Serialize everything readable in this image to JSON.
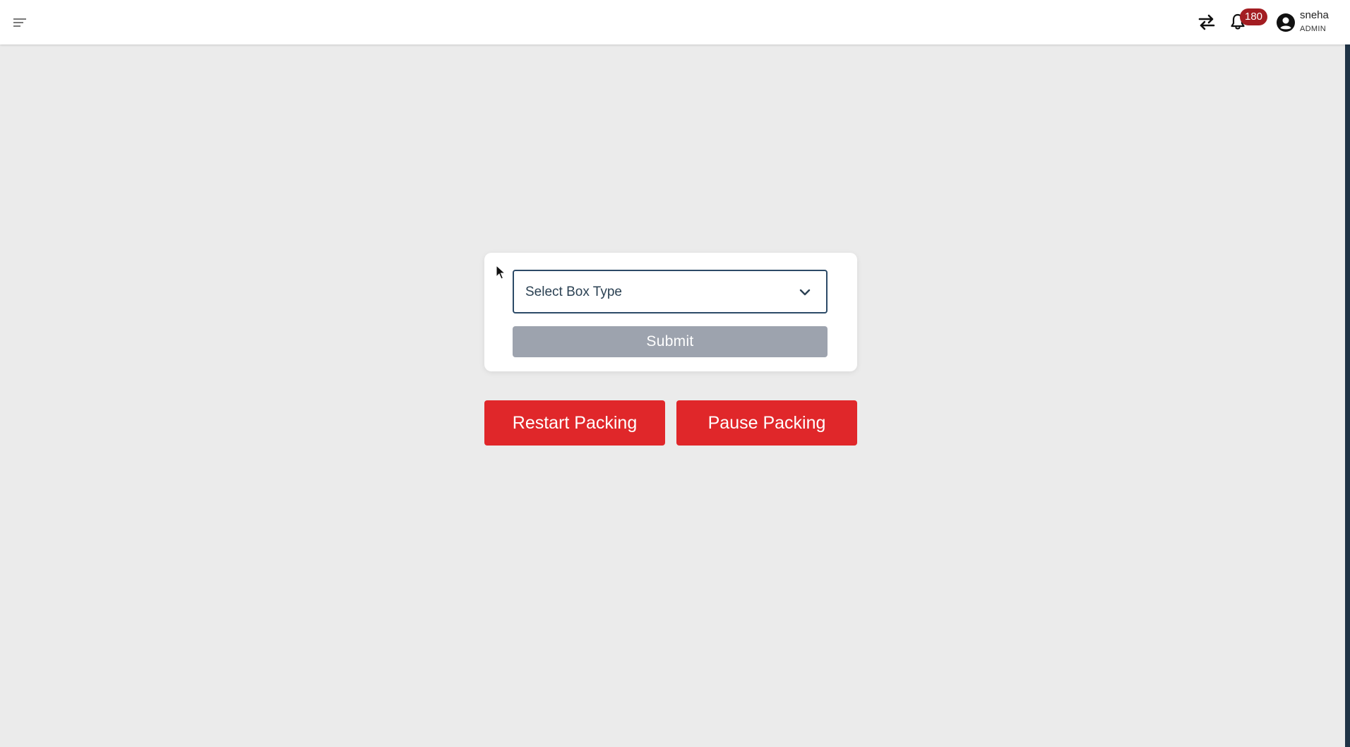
{
  "header": {
    "menu_icon": "hamburger-menu-icon",
    "swap_icon": "swap-arrows-icon",
    "bell_icon": "bell-icon",
    "notification_count": "180",
    "badge_color": "#a31d22",
    "user_icon": "account-circle-icon",
    "user": {
      "name": "sneha",
      "role": "ADMIN"
    }
  },
  "form": {
    "select_placeholder": "Select Box Type",
    "chevron_icon": "chevron-down-icon",
    "submit_label": "Submit",
    "submit_color": "#9da3ae"
  },
  "actions": {
    "restart_label": "Restart Packing",
    "pause_label": "Pause Packing",
    "accent_color": "#e0272a"
  },
  "colors": {
    "background": "#ebebeb",
    "topbar": "#ffffff",
    "select_border": "#2c4a67"
  }
}
